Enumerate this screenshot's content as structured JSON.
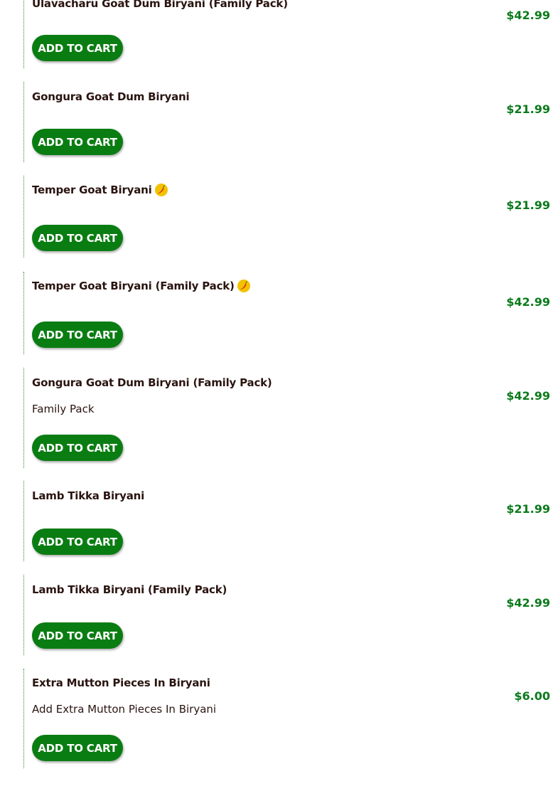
{
  "colors": {
    "button_bg": "#0a7d12",
    "price": "#0a7a1b",
    "name": "#2a1410",
    "spicy_badge": "#f2c200"
  },
  "add_to_cart_label": "ADD TO CART",
  "items": [
    {
      "name": "Ulavacharu Goat Dum Biryani (Family Pack)",
      "description": "",
      "price": "$42.99",
      "spicy": false
    },
    {
      "name": "Gongura Goat Dum Biryani",
      "description": "",
      "price": "$21.99",
      "spicy": false
    },
    {
      "name": "Temper Goat Biryani",
      "description": "",
      "price": "$21.99",
      "spicy": true,
      "spicy_icon": "chili-pepper-icon"
    },
    {
      "name": "Temper Goat Biryani (Family Pack)",
      "description": "",
      "price": "$42.99",
      "spicy": true,
      "spicy_icon": "chili-pepper-icon"
    },
    {
      "name": "Gongura Goat Dum Biryani (Family Pack)",
      "description": "Family Pack",
      "price": "$42.99",
      "spicy": false
    },
    {
      "name": "Lamb Tikka Biryani",
      "description": "",
      "price": "$21.99",
      "spicy": false
    },
    {
      "name": "Lamb Tikka Biryani (Family Pack)",
      "description": "",
      "price": "$42.99",
      "spicy": false
    },
    {
      "name": "Extra Mutton Pieces In Biryani",
      "description": "Add Extra Mutton Pieces In Biryani",
      "price": "$6.00",
      "spicy": false
    }
  ]
}
